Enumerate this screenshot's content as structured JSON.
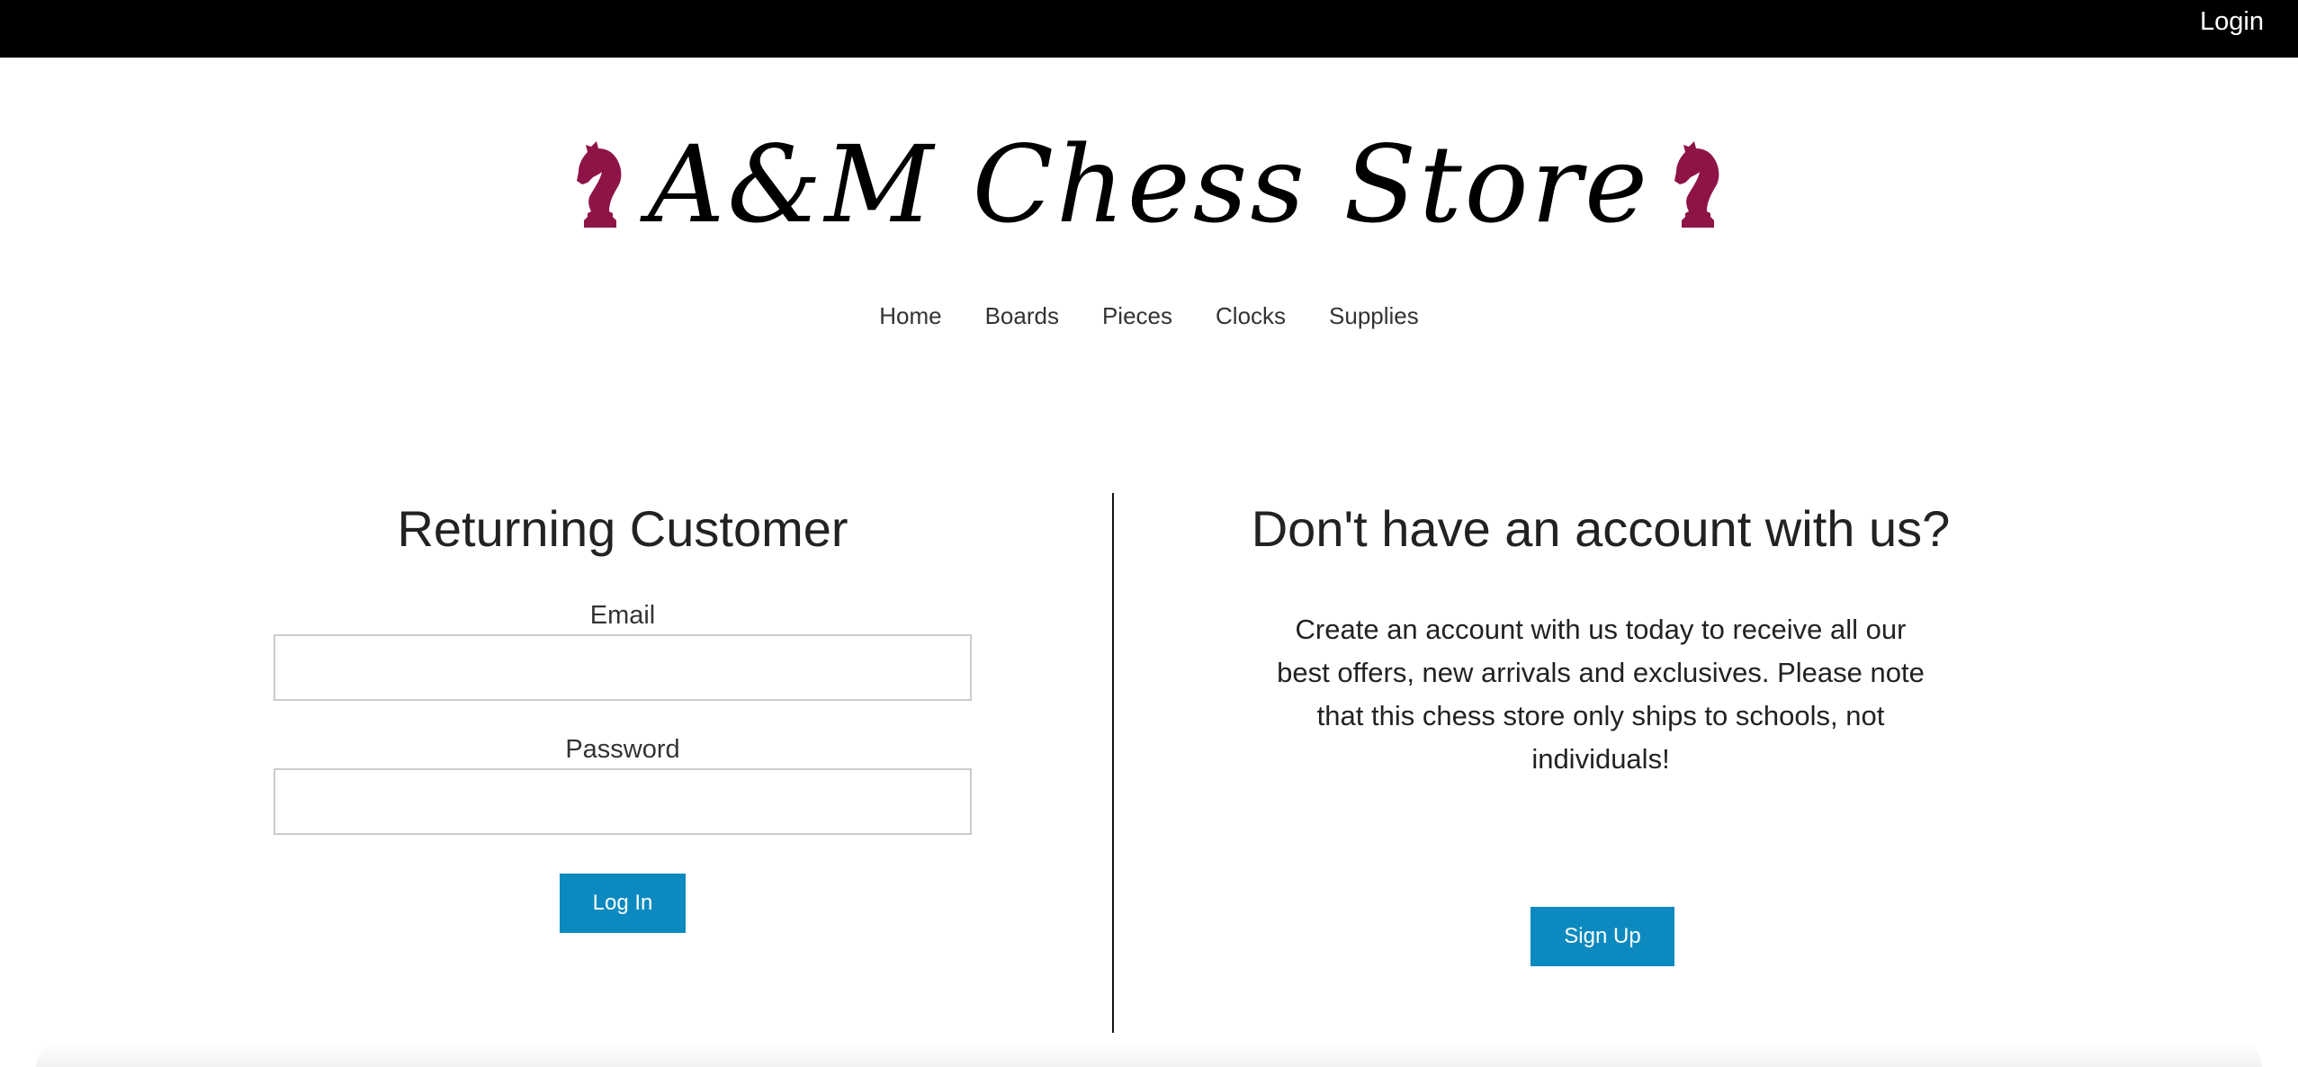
{
  "topbar": {
    "login_label": "Login"
  },
  "brand": {
    "name": "A&M Chess Store",
    "accent_color": "#8e1448"
  },
  "nav": {
    "items": [
      {
        "label": "Home"
      },
      {
        "label": "Boards"
      },
      {
        "label": "Pieces"
      },
      {
        "label": "Clocks"
      },
      {
        "label": "Supplies"
      }
    ]
  },
  "login": {
    "title": "Returning Customer",
    "email_label": "Email",
    "email_value": "",
    "password_label": "Password",
    "password_value": "",
    "submit_label": "Log In"
  },
  "signup": {
    "title": "Don't have an account with us?",
    "text": "Create an account with us today to receive all our best offers, new arrivals and exclusives. Please note that this chess store only ships to schools, not individuals!",
    "button_label": "Sign Up"
  },
  "colors": {
    "button": "#0c8ac0",
    "topbar": "#000000"
  },
  "icons": {
    "logo_left": "chess-knight-icon",
    "logo_right": "chess-knight-icon"
  }
}
